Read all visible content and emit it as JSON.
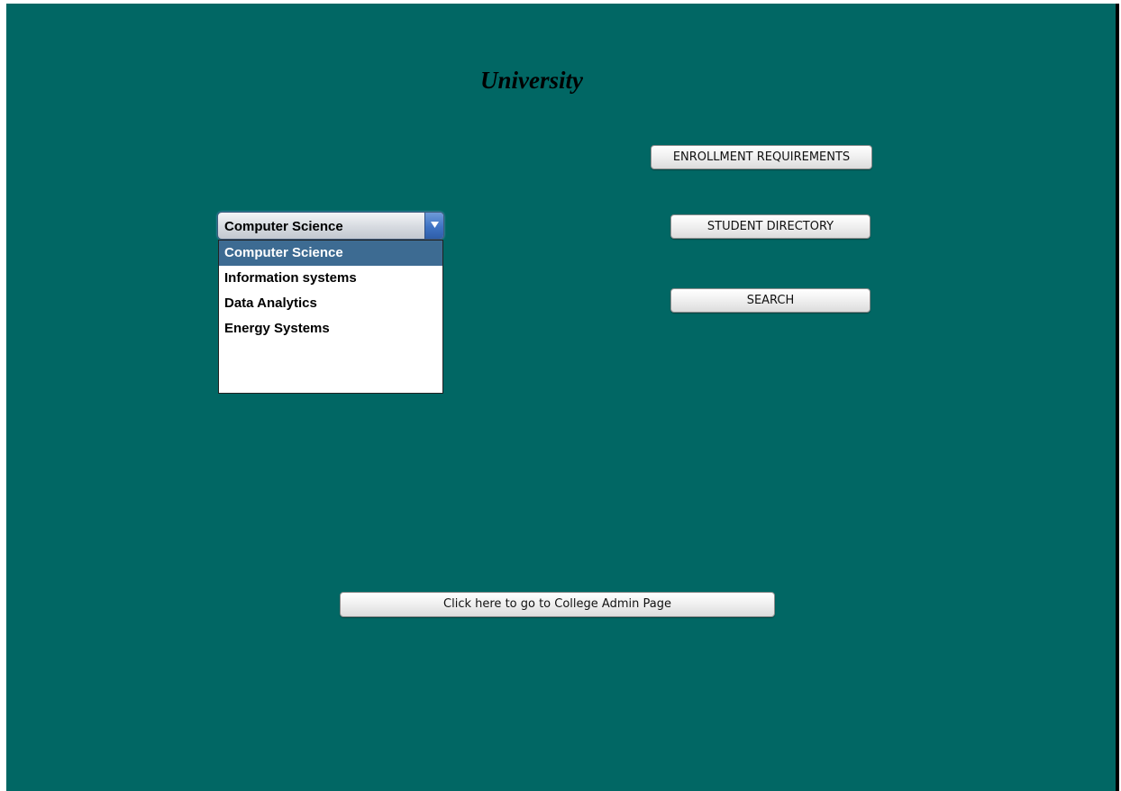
{
  "window": {
    "title": "University"
  },
  "buttons": {
    "enrollment": "ENROLLMENT REQUIREMENTS",
    "directory": "STUDENT DIRECTORY",
    "search": "SEARCH",
    "admin": "Click here to go to College Admin Page"
  },
  "program_select": {
    "selected": "Computer Science",
    "options": [
      "Computer Science",
      "Information systems",
      "Data Analytics",
      "Energy Systems"
    ],
    "highlighted_option": "Computer Science"
  },
  "colors": {
    "background": "#016764",
    "selection": "#3d6b92",
    "dropdown_arrow": "#3f73c4"
  }
}
